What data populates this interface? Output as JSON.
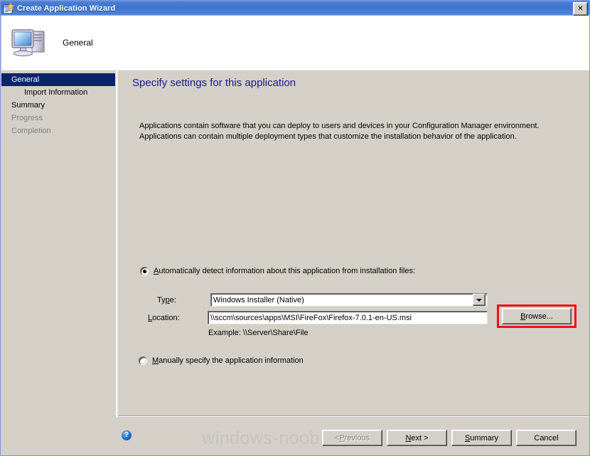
{
  "window": {
    "title": "Create Application Wizard",
    "title_icon": "wizard-app-icon",
    "close_label": "✕"
  },
  "header": {
    "step_title": "General",
    "icon": "computer-icon"
  },
  "sidebar": {
    "items": [
      {
        "label": "General",
        "state": "selected",
        "indent": false
      },
      {
        "label": "Import Information",
        "state": "normal",
        "indent": true
      },
      {
        "label": "Summary",
        "state": "normal",
        "indent": false
      },
      {
        "label": "Progress",
        "state": "disabled",
        "indent": false
      },
      {
        "label": "Completion",
        "state": "disabled",
        "indent": false
      }
    ]
  },
  "content": {
    "heading": "Specify settings for this application",
    "description": "Applications contain software that you can deploy to users and devices in your Configuration Manager environment. Applications can contain multiple deployment types that customize the installation behavior of the application.",
    "auto_radio": {
      "label_prefix": "",
      "accel": "A",
      "label_rest": "utomatically detect information about this application from installation files:",
      "checked": true
    },
    "type_label_prefix": "Ty",
    "type_label_accel": "p",
    "type_label_rest": "e:",
    "type_value": "Windows Installer (Native)",
    "location_label_accel": "L",
    "location_label_rest": "ocation:",
    "location_value": "\\\\sccm\\sources\\apps\\MSI\\FireFox\\Firefox-7.0.1-en-US.msi",
    "example_text": "Example: \\\\Server\\Share\\File",
    "browse_accel": "B",
    "browse_rest": "rowse...",
    "manual_radio": {
      "accel": "M",
      "label_rest": "anually specify the application information",
      "checked": false
    }
  },
  "footer": {
    "help_glyph": "?",
    "watermark": "windows-noob.com",
    "buttons": [
      {
        "name": "previous",
        "prefix": "< ",
        "accel": "P",
        "rest": "revious",
        "disabled": true
      },
      {
        "name": "next",
        "prefix": "",
        "accel": "N",
        "rest": "ext >",
        "disabled": false
      },
      {
        "name": "summary",
        "prefix": "",
        "accel": "S",
        "rest": "ummary",
        "disabled": false
      },
      {
        "name": "cancel",
        "prefix": "",
        "accel": "",
        "rest": "Cancel",
        "disabled": false
      }
    ]
  },
  "colors": {
    "title_bar": "#3f74cf",
    "selection": "#0a246a",
    "heading": "#1a1a8c",
    "dialog_face": "#d4d0c8",
    "highlight_box": "#ee1111"
  }
}
